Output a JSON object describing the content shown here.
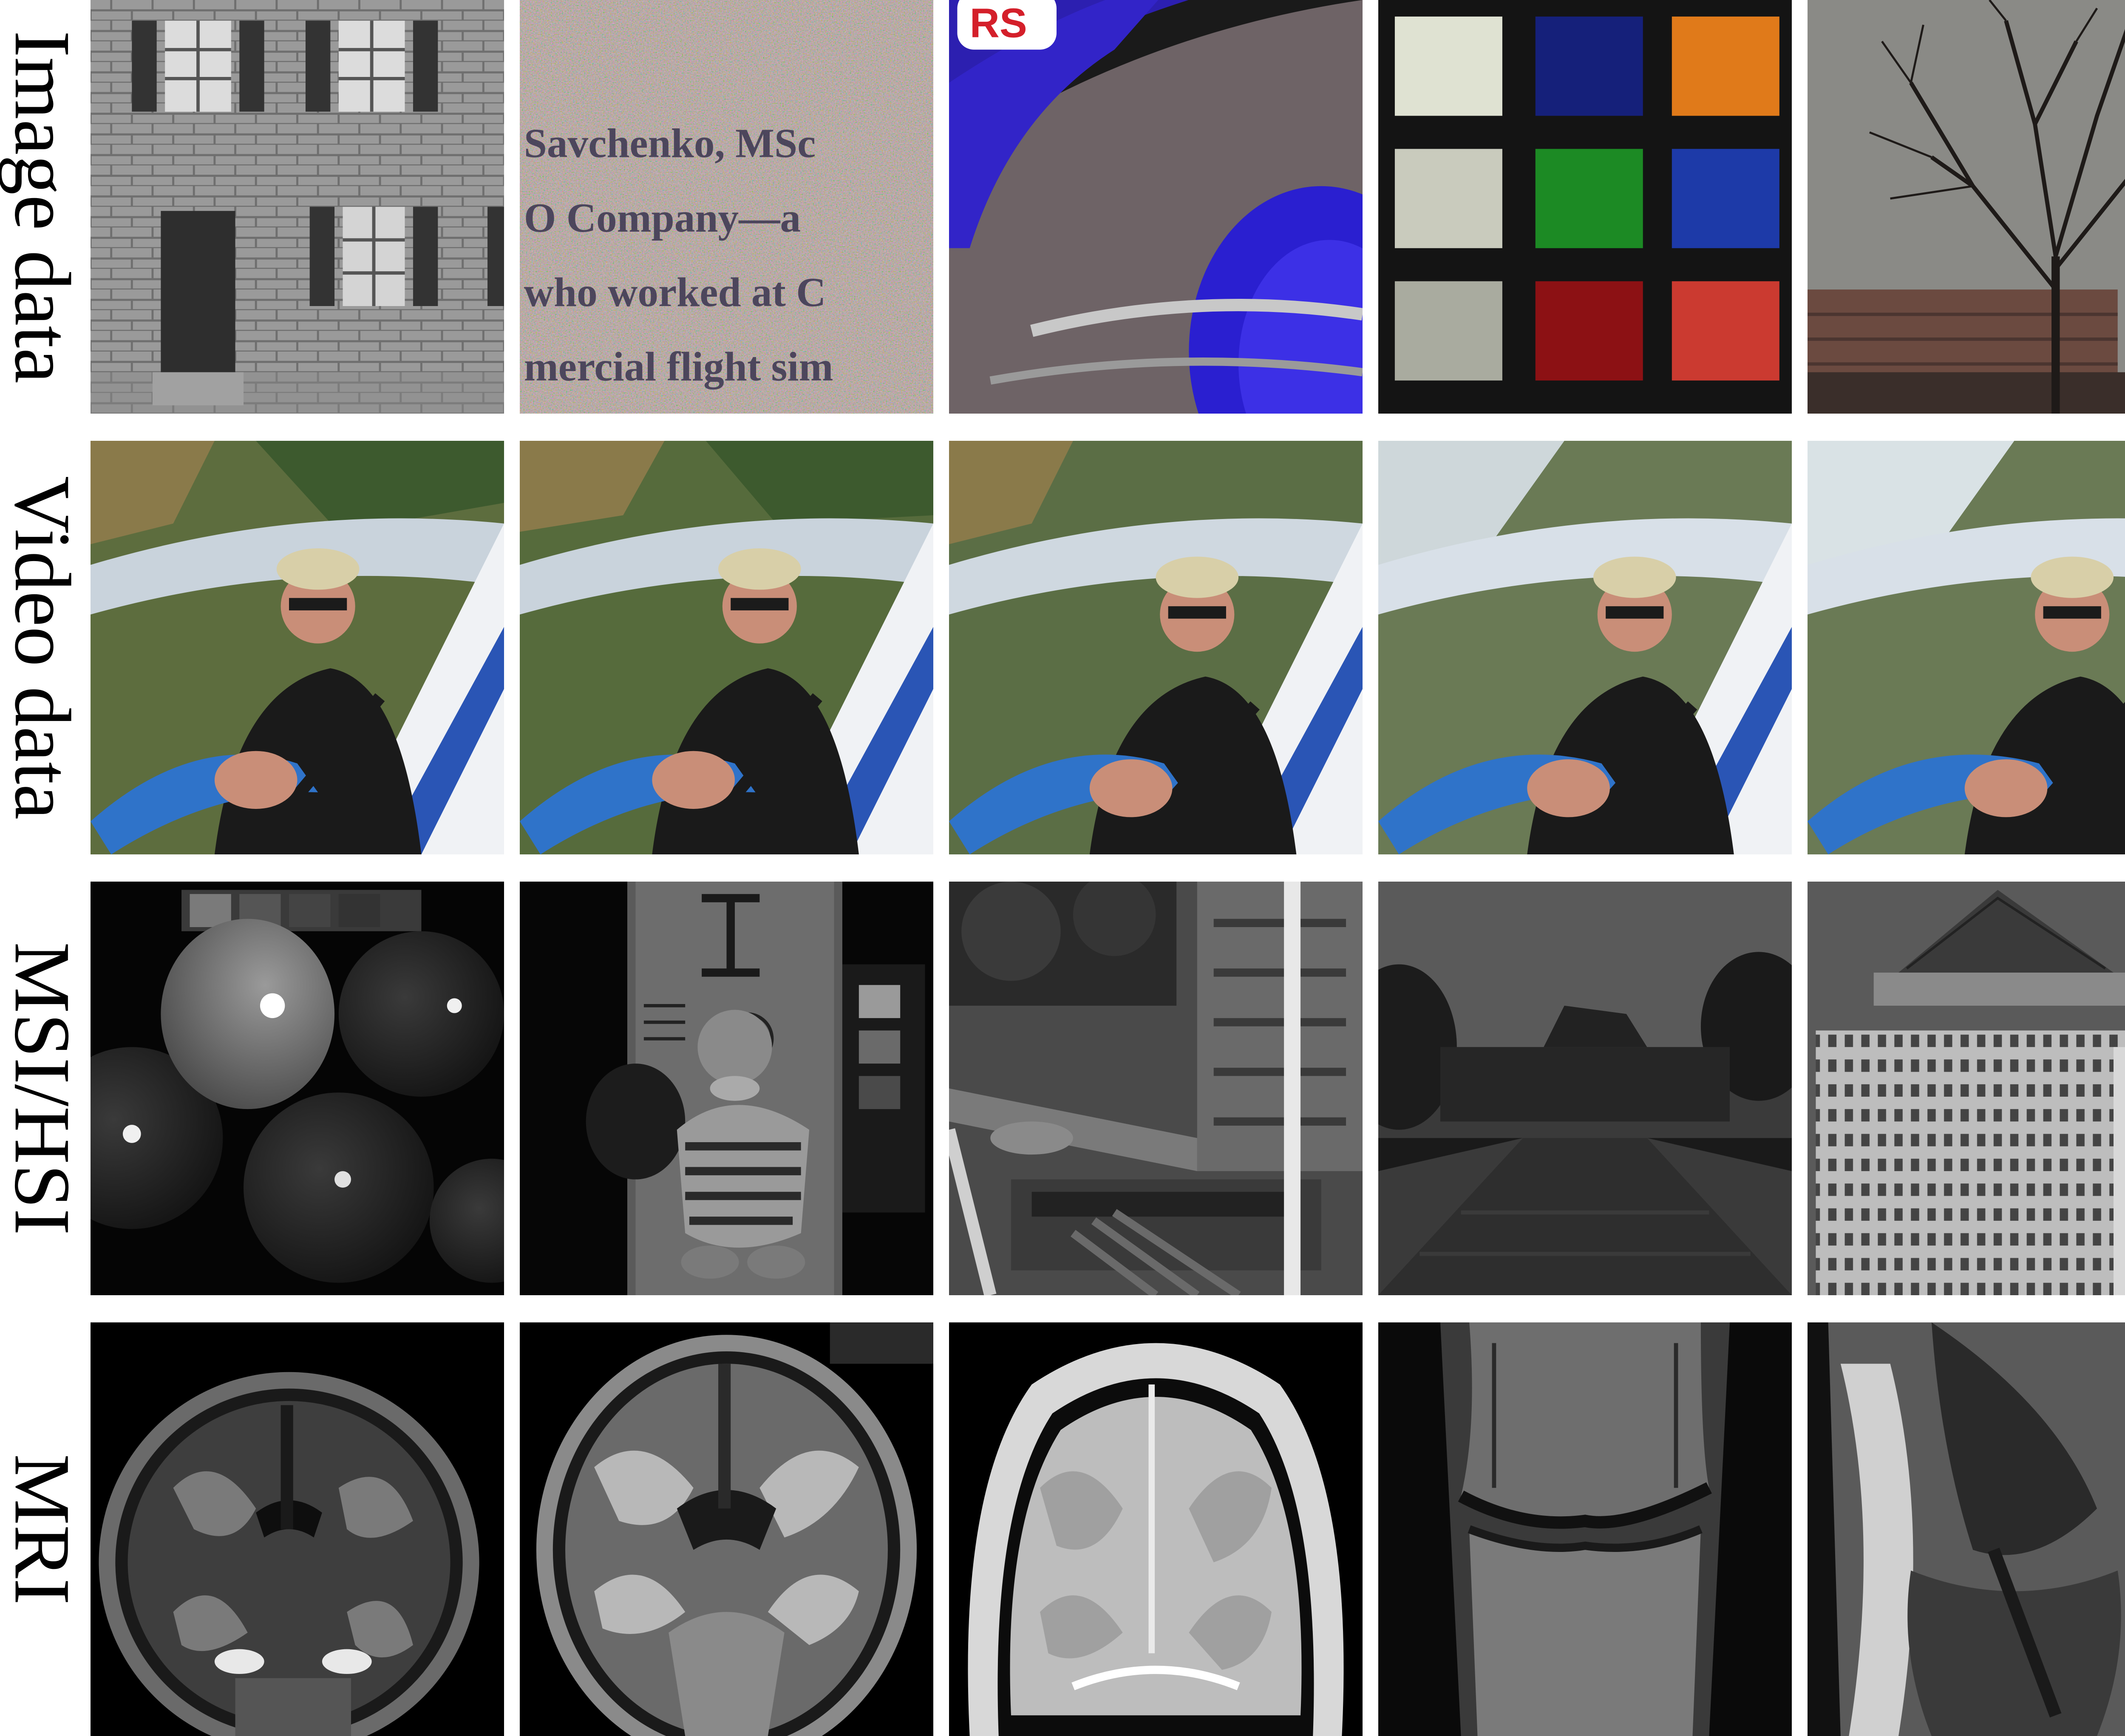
{
  "rows": [
    {
      "label": "Image data"
    },
    {
      "label": "Video data"
    },
    {
      "label": "MSI/HSI"
    },
    {
      "label": "MRI"
    }
  ],
  "image_text": {
    "noisy_text_lines": [
      "Savchenko, MSc",
      "O Company—a",
      "who worked at C",
      "mercial flight sim"
    ],
    "logo_letters": "RS"
  }
}
